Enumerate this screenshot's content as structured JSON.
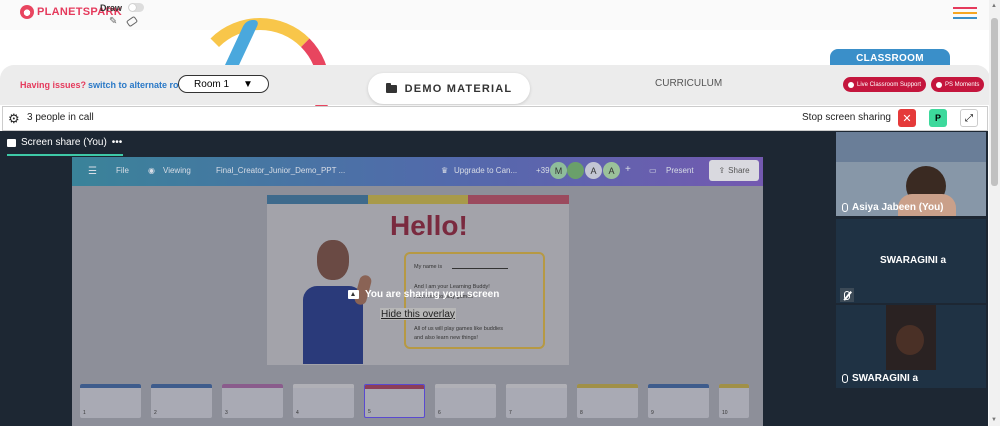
{
  "header": {
    "logo_text": "PLANETSPARK",
    "draw_label": "Draw",
    "icons": [
      "pencil-icon",
      "eraser-icon"
    ],
    "menu_icon": "hamburger-icon",
    "menu_colors": [
      "#e53a5c",
      "#f6a623",
      "#3a8fc9"
    ]
  },
  "room_bar": {
    "issues_text": "Having issues?",
    "switch_link": "switch to alternate room",
    "room_select": "Room 1",
    "demo_material": "DEMO MATERIAL",
    "curriculum": "CURRICULUM",
    "classroom_tab": "CLASSROOM",
    "live_support": "Live Classroom Support",
    "ps_moments": "PS Moments"
  },
  "call": {
    "people_count": "3 people in call",
    "stop_sharing": "Stop screen sharing",
    "p_button": "P",
    "screen_share_tab": "Screen share (You)",
    "tab_menu": "•••"
  },
  "shared_screen": {
    "toolbar": {
      "file": "File",
      "viewing": "Viewing",
      "doc_title": "Final_Creator_Junior_Demo_PPT ...",
      "upgrade": "Upgrade to Can...",
      "count": "+39",
      "avatars": [
        "M",
        "",
        "A",
        "A"
      ],
      "plus": "+",
      "present": "Present",
      "share": "Share"
    },
    "slide": {
      "title": "Hello!",
      "lines": [
        "My name is",
        "And I am your Learning Buddy!",
        "I am here to play games",
        "All of us will play games like buddies",
        "and also learn new things!"
      ]
    },
    "overlay_message": "You are sharing your screen",
    "hide_overlay": "Hide this overlay",
    "thumbnails": [
      "1",
      "2",
      "3",
      "4",
      "5",
      "6",
      "7",
      "8",
      "9",
      "10"
    ]
  },
  "participants": [
    {
      "name": "Asiya Jabeen (You)",
      "muted": false
    },
    {
      "name": "SWARAGINI a",
      "muted": true
    },
    {
      "name": "SWARAGINI a",
      "muted": false
    }
  ]
}
